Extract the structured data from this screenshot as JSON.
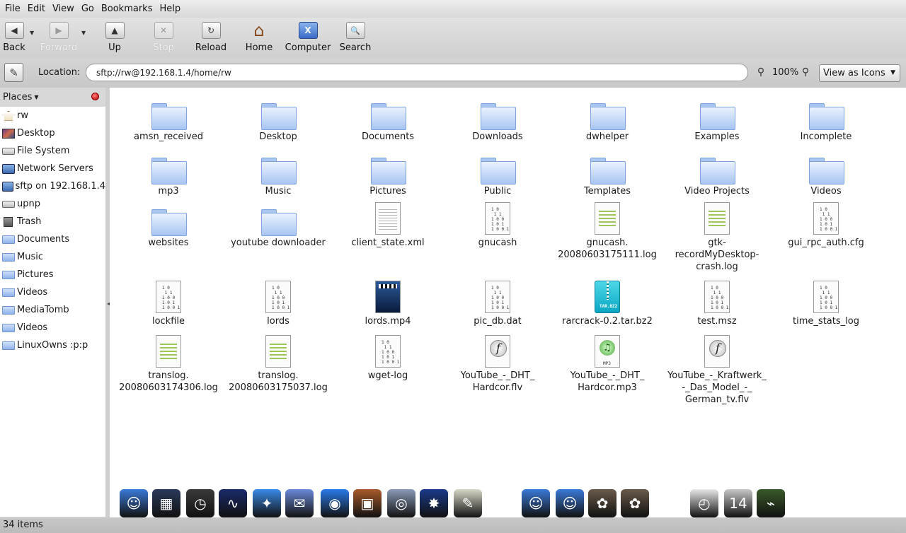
{
  "menu": [
    {
      "name": "menu-file",
      "label": "File"
    },
    {
      "name": "menu-edit",
      "label": "Edit"
    },
    {
      "name": "menu-view",
      "label": "View"
    },
    {
      "name": "menu-go",
      "label": "Go"
    },
    {
      "name": "menu-bookmarks",
      "label": "Bookmarks"
    },
    {
      "name": "menu-help",
      "label": "Help"
    }
  ],
  "toolbar": {
    "back": {
      "label": "Back",
      "icon": "◀"
    },
    "forward": {
      "label": "Forward",
      "icon": "▶"
    },
    "up": {
      "label": "Up",
      "icon": "▲"
    },
    "stop": {
      "label": "Stop",
      "icon": "✕"
    },
    "reload": {
      "label": "Reload",
      "icon": "↻"
    },
    "home": {
      "label": "Home",
      "icon": "⌂"
    },
    "computer": {
      "label": "Computer",
      "icon": "X"
    },
    "search": {
      "label": "Search",
      "icon": "🔍"
    }
  },
  "location": {
    "label": "Location:",
    "value": "sftp://rw@192.168.1.4/home/rw",
    "zoom": "100%",
    "view_mode": "View as Icons"
  },
  "sidebar": {
    "header": "Places",
    "items": [
      {
        "label": "rw",
        "icon": "home"
      },
      {
        "label": "Desktop",
        "icon": "desktop"
      },
      {
        "label": "File System",
        "icon": "drive"
      },
      {
        "label": "Network Servers",
        "icon": "net"
      },
      {
        "label": "sftp on 192.168.1.4",
        "icon": "net"
      },
      {
        "label": "upnp",
        "icon": "drive"
      },
      {
        "label": "Trash",
        "icon": "trash"
      },
      {
        "label": "Documents",
        "icon": "folder"
      },
      {
        "label": "Music",
        "icon": "folder"
      },
      {
        "label": "Pictures",
        "icon": "folder"
      },
      {
        "label": "Videos",
        "icon": "folder"
      },
      {
        "label": "MediaTomb",
        "icon": "folder"
      },
      {
        "label": "Videos",
        "icon": "folder"
      },
      {
        "label": "LinuxOwns :p:p",
        "icon": "folder"
      }
    ]
  },
  "files": [
    {
      "name": "amsn_received",
      "type": "folder"
    },
    {
      "name": "Desktop",
      "type": "folder"
    },
    {
      "name": "Documents",
      "type": "folder"
    },
    {
      "name": "Downloads",
      "type": "folder"
    },
    {
      "name": "dwhelper",
      "type": "folder"
    },
    {
      "name": "Examples",
      "type": "folder"
    },
    {
      "name": "Incomplete",
      "type": "folder"
    },
    {
      "name": "mp3",
      "type": "folder"
    },
    {
      "name": "Music",
      "type": "folder"
    },
    {
      "name": "Pictures",
      "type": "folder"
    },
    {
      "name": "Public",
      "type": "folder"
    },
    {
      "name": "Templates",
      "type": "folder"
    },
    {
      "name": "Video Projects",
      "type": "folder"
    },
    {
      "name": "Videos",
      "type": "folder"
    },
    {
      "name": "websites",
      "type": "folder"
    },
    {
      "name": "youtube downloader",
      "type": "folder"
    },
    {
      "name": "client_state.xml",
      "type": "xml"
    },
    {
      "name": "gnucash",
      "type": "binary"
    },
    {
      "name": "gnucash.\n20080603175111.log",
      "type": "text"
    },
    {
      "name": "gtk-\nrecordMyDesktop-\ncrash.log",
      "type": "text"
    },
    {
      "name": "gui_rpc_auth.cfg",
      "type": "binary"
    },
    {
      "name": "lockfile",
      "type": "binary"
    },
    {
      "name": "lords",
      "type": "binary"
    },
    {
      "name": "lords.mp4",
      "type": "video"
    },
    {
      "name": "pic_db.dat",
      "type": "binary"
    },
    {
      "name": "rarcrack-0.2.tar.bz2",
      "type": "archive"
    },
    {
      "name": "test.msz",
      "type": "binary"
    },
    {
      "name": "time_stats_log",
      "type": "binary"
    },
    {
      "name": "translog.\n20080603174306.log",
      "type": "text"
    },
    {
      "name": "translog.\n20080603175037.log",
      "type": "text"
    },
    {
      "name": "wget-log",
      "type": "binary"
    },
    {
      "name": "YouTube_-_DHT_\nHardcor.flv",
      "type": "flash"
    },
    {
      "name": "YouTube_-_DHT_\nHardcor.mp3",
      "type": "mp3"
    },
    {
      "name": "YouTube_-_Kraftwerk_\n-_Das_Model_-_\nGerman_tv.flv",
      "type": "flash"
    }
  ],
  "icon_badges": {
    "binary_text": "1 0\n 1 1\n1 0 0\n1 0 1\n1 0 0 1",
    "archive_text": "TAR.BZ2",
    "mp3_text": "MP3"
  },
  "status": {
    "text": "34 items"
  },
  "dock": {
    "items": [
      {
        "name": "finder-dock-icon",
        "glyph": "☺",
        "color": "#3a7ad8"
      },
      {
        "name": "dashboard-dock-icon",
        "glyph": "▦",
        "color": "#2a3a5a"
      },
      {
        "name": "time-machine-dock-icon",
        "glyph": "◷",
        "color": "#3a3a3a"
      },
      {
        "name": "activity-monitor-dock-icon",
        "glyph": "∿",
        "color": "#1a2a6a"
      },
      {
        "name": "safari-dock-icon",
        "glyph": "✦",
        "color": "#3a8ae8"
      },
      {
        "name": "mail-dock-icon",
        "glyph": "✉",
        "color": "#6a8ad8"
      },
      {
        "name": "ichat-dock-icon",
        "glyph": "◉",
        "color": "#2a7ae8"
      },
      {
        "name": "photo-dock-icon",
        "glyph": "▣",
        "color": "#a85a2a"
      },
      {
        "name": "preview-dock-icon",
        "glyph": "◎",
        "color": "#8a9ab8"
      },
      {
        "name": "imovie-dock-icon",
        "glyph": "✸",
        "color": "#1a3a8a"
      },
      {
        "name": "textedit-dock-icon",
        "glyph": "✎",
        "color": "#d8d8c8"
      },
      {
        "name": "finder2-dock-icon",
        "glyph": "☺",
        "color": "#3a7ad8"
      },
      {
        "name": "finder3-dock-icon",
        "glyph": "☺",
        "color": "#3a7ad8"
      },
      {
        "name": "gimp-dock-icon",
        "glyph": "✿",
        "color": "#6a5a4a"
      },
      {
        "name": "gimp2-dock-icon",
        "glyph": "✿",
        "color": "#6a5a4a"
      },
      {
        "name": "clock-dock-icon",
        "glyph": "◴",
        "color": "#e8e8e8"
      },
      {
        "name": "trash-dock-icon",
        "glyph": "14",
        "color": "#c8c8c8"
      },
      {
        "name": "terminal-dock-icon",
        "glyph": "⌁",
        "color": "#3a5a2a"
      }
    ]
  }
}
